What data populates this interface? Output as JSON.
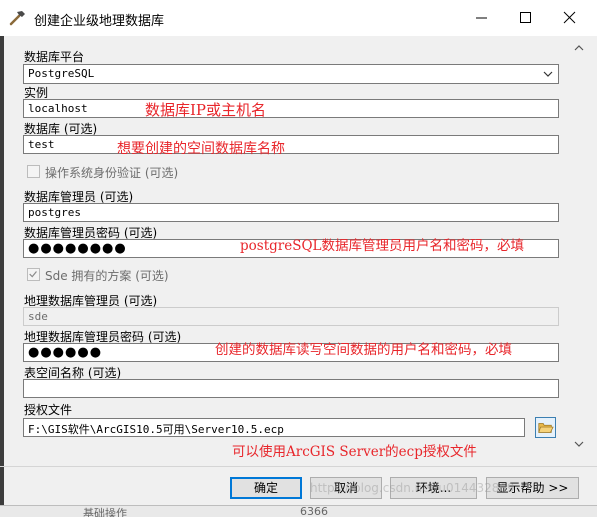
{
  "window": {
    "title": "创建企业级地理数据库",
    "minimize_icon": "minimize-icon",
    "maximize_icon": "maximize-icon",
    "close_icon": "close-icon"
  },
  "form": {
    "platform_label": "数据库平台",
    "platform_value": "PostgreSQL",
    "instance_label": "实例",
    "instance_value": "localhost",
    "database_label": "数据库 (可选)",
    "database_value": "test",
    "os_auth_label": "操作系统身份验证 (可选)",
    "os_auth_checked": false,
    "db_admin_label": "数据库管理员 (可选)",
    "db_admin_value": "postgres",
    "db_admin_password_label": "数据库管理员密码 (可选)",
    "db_admin_password_value": "●●●●●●●●",
    "sde_schema_label": "Sde 拥有的方案 (可选)",
    "sde_schema_checked": true,
    "gdb_admin_label": "地理数据库管理员 (可选)",
    "gdb_admin_value": "sde",
    "gdb_admin_password_label": "地理数据库管理员密码 (可选)",
    "gdb_admin_password_value": "●●●●●●",
    "tablespace_label": "表空间名称 (可选)",
    "tablespace_value": "",
    "auth_file_label": "授权文件",
    "auth_file_value": "F:\\GIS软件\\ArcGIS10.5可用\\Server10.5.ecp"
  },
  "annotations": {
    "instance_note": "数据库IP或主机名",
    "database_note": "想要创建的空间数据库名称",
    "db_admin_note": "postgreSQL数据库管理员用户名和密码，必填",
    "gdb_admin_note": "创建的数据库读写空间数据的用户名和密码，必填",
    "auth_file_note": "可以使用ArcGIS Server的ecp授权文件"
  },
  "buttons": {
    "ok": "确定",
    "cancel": "取消",
    "environments": "环境...",
    "show_help": "显示帮助 >>"
  },
  "background": {
    "left_peek": "基础操作",
    "right_peek": "6366"
  },
  "watermark": "https://blog.csdn.net/u014432809",
  "colors": {
    "annotation": "#e8262b",
    "dialog_bg": "#f0f0f0",
    "primary_border": "#0078d7"
  }
}
